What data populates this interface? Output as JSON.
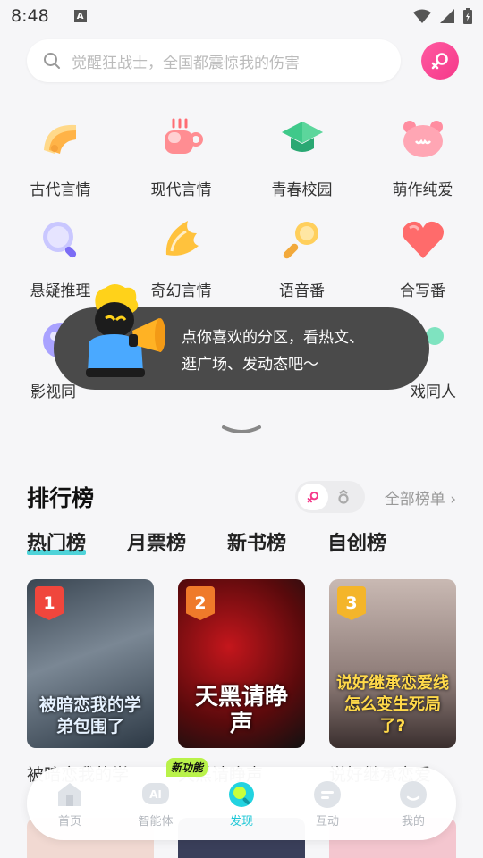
{
  "status": {
    "time": "8:48"
  },
  "search": {
    "placeholder": "觉醒狂战士，全国都震惊我的伤害"
  },
  "categories": [
    {
      "label": "古代言情",
      "icon": "fan-icon"
    },
    {
      "label": "现代言情",
      "icon": "coffee-cup-icon"
    },
    {
      "label": "青春校园",
      "icon": "graduation-cap-icon"
    },
    {
      "label": "萌作纯爱",
      "icon": "bear-icon"
    },
    {
      "label": "悬疑推理",
      "icon": "magnifier-icon"
    },
    {
      "label": "奇幻言情",
      "icon": "wing-icon"
    },
    {
      "label": "语音番",
      "icon": "microphone-icon"
    },
    {
      "label": "合写番",
      "icon": "heart-icon"
    },
    {
      "label": "影视同",
      "icon": "film-icon"
    },
    {
      "label": "戏同人",
      "icon": "game-icon"
    }
  ],
  "tooltip": {
    "line1": "点你喜欢的分区，看热文、",
    "line2": "逛广场、发动态吧～"
  },
  "ranking": {
    "title": "排行榜",
    "all_label": "全部榜单",
    "tabs": [
      "热门榜",
      "月票榜",
      "新书榜",
      "自创榜"
    ],
    "books": [
      {
        "rank": "1",
        "cover_title": "被暗恋我的学弟包围了",
        "name": "被暗恋我的学",
        "accent": "#f0463c"
      },
      {
        "rank": "2",
        "cover_title": "天黑请睁声",
        "name": "天黑请睁声",
        "accent": "#ef7a2a"
      },
      {
        "rank": "3",
        "cover_title": "说好继承恋爱线怎么变生死局了?",
        "name": "说好继承恋爱",
        "accent": "#f4b52a"
      }
    ]
  },
  "nav": {
    "new_badge": "新功能",
    "items": [
      {
        "label": "首页",
        "icon": "home-icon"
      },
      {
        "label": "智能体",
        "icon": "ai-icon"
      },
      {
        "label": "发现",
        "icon": "discover-icon"
      },
      {
        "label": "互动",
        "icon": "chat-icon"
      },
      {
        "label": "我的",
        "icon": "profile-icon"
      }
    ]
  },
  "colors": {
    "accent": "#1ec7d6",
    "pink": "#f5398a",
    "tooltip_bg": "#4a4a4a"
  }
}
